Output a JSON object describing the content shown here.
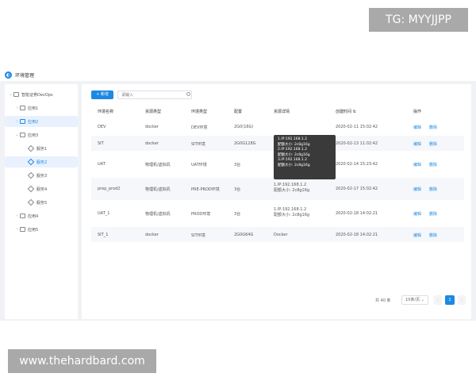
{
  "watermark_top": "TG: MYYJJPP",
  "watermark_bottom": "www.thehardbard.com",
  "app": {
    "title": "环境管理"
  },
  "sidebar": {
    "items": [
      {
        "label": "智能证券DevOps",
        "caret": "⌄",
        "type": "root"
      },
      {
        "label": "应用1",
        "caret": "›",
        "type": "folder"
      },
      {
        "label": "应用2",
        "caret": "›",
        "type": "folder",
        "selected": true
      },
      {
        "label": "应用3",
        "caret": "⌄",
        "type": "folder"
      },
      {
        "label": "服务1",
        "type": "service"
      },
      {
        "label": "服务2",
        "type": "service",
        "selected": true
      },
      {
        "label": "服务3",
        "type": "service"
      },
      {
        "label": "服务4",
        "type": "service"
      },
      {
        "label": "服务5",
        "type": "service"
      },
      {
        "label": "应用4",
        "caret": "›",
        "type": "folder"
      },
      {
        "label": "应用5",
        "caret": "›",
        "type": "folder"
      }
    ]
  },
  "toolbar": {
    "add_label": "+ 新增",
    "search_placeholder": "请输入"
  },
  "table": {
    "headers": [
      "环境名称",
      "资源类型",
      "环境类型",
      "配置",
      "资源详情",
      "创建时间 ⇅",
      "操作"
    ],
    "rows": [
      {
        "name": "DEV",
        "resource": "docker",
        "env": "DEV环境",
        "config": "2G0(16G)",
        "detail": "",
        "created": "2020-02-11  15:02:42",
        "edit": "编辑",
        "del": "删除"
      },
      {
        "name": "SIT",
        "resource": "docker",
        "env": "SIT环境",
        "config": "2G0G128G",
        "detail": "",
        "created": "2020-02-13  11:02:42",
        "edit": "编辑",
        "del": "删除"
      },
      {
        "name": "UAT",
        "resource": "物理机/虚拟机",
        "env": "UAT环境",
        "config": "3台",
        "detail": "",
        "created": "2020-02-14  15:23:42",
        "edit": "编辑",
        "del": "删除"
      },
      {
        "name": "prep_prod2",
        "resource": "物理机/虚拟机",
        "env": "PRE-PROD环境",
        "config": "3台",
        "detail": "1.IP:192.168.1.2\n配额大小: 2c8g16g",
        "created": "2020-02-17  15:02:42",
        "edit": "编辑",
        "del": "删除"
      },
      {
        "name": "UAT_1",
        "resource": "物理机/虚拟机",
        "env": "PROD环境",
        "config": "3台",
        "detail": "1.IP:192.168.1.2\n配额大小: 2c8g16g",
        "created": "2020-02-18  14:02:21",
        "edit": "编辑",
        "del": "删除"
      },
      {
        "name": "SIT_1",
        "resource": "docker",
        "env": "SIT环境",
        "config": "2G0G64G",
        "detail": "Docker",
        "created": "2020-02-18  14:02:21",
        "edit": "编辑",
        "del": "删除"
      }
    ]
  },
  "tooltip": {
    "lines": [
      "1.IP:192.168.1.2",
      "配额大小: 2c8g16g",
      "2.IP:192.168.1.2",
      "配额大小: 2c8g16g",
      "3.IP:192.168.1.2",
      "配额大小: 2c8g16g"
    ]
  },
  "pagination": {
    "total": "共 40 条",
    "page_size": "10条/页 ⌄",
    "prev": "‹",
    "current": "1",
    "next": "›"
  }
}
